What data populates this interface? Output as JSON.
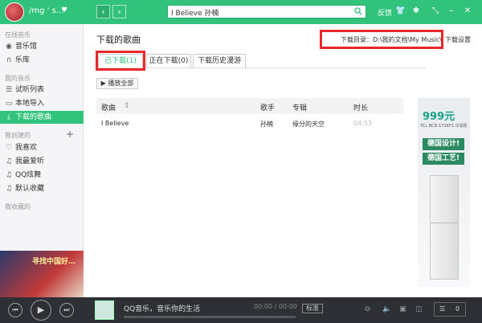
{
  "topbar": {
    "username": "/mg ' s...",
    "search_value": "I Believe 孙楠",
    "feedback": "反馈",
    "back_glyph": "‹",
    "forward_glyph": "›",
    "skin_icon": "tshirt-icon",
    "settings_icon": "gear-icon"
  },
  "sidebar": {
    "section_online": "在线音乐",
    "music_hall": "音乐馆",
    "library": "乐库",
    "section_mine": "我的音乐",
    "trial_list": "试听列表",
    "local_import": "本地导入",
    "downloaded_songs": "下载的歌曲",
    "section_created": "我创建的",
    "favorites": "我喜欢",
    "my_most_listened": "我最爱听",
    "qq_dance": "QQ炫舞",
    "default_collection": "默认收藏",
    "section_collected": "我收藏的",
    "ad_text": "寻找中国好…"
  },
  "main": {
    "title": "下载的歌曲",
    "download_dir": "下载目录：D:\\我的文档\\My Music\\",
    "download_settings": "下载设置",
    "tabs": [
      {
        "label": "已下载(1)"
      },
      {
        "label": "正在下载(0)"
      },
      {
        "label": "下载历史漫游"
      }
    ],
    "play_all": "▶ 播放全部",
    "columns": {
      "song": "歌曲",
      "sort_glyph": "⇕",
      "singer": "歌手",
      "album": "专辑",
      "duration": "时长"
    },
    "rows": [
      {
        "song": "I Believe",
        "singer": "孙楠",
        "album": "缘分的天空",
        "duration": "04:53"
      }
    ]
  },
  "ad_right": {
    "price": "999元",
    "sub": "TCL BCD-171KF1 冷冻柜",
    "slogan1": "德国设计!",
    "slogan2": "德国工艺!"
  },
  "player": {
    "now_playing": "QQ音乐，音乐你的生活",
    "time": "00:00 / 00:00",
    "quality": "标准",
    "queue_count": "0",
    "accent": "#31c27c"
  }
}
